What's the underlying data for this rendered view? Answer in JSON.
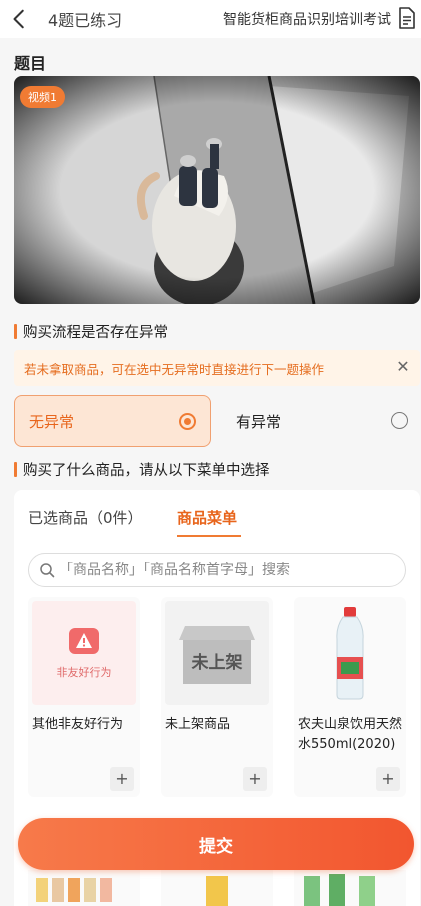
{
  "header": {
    "progress": "4题已练习",
    "title": "智能货柜商品识别培训考试"
  },
  "section_title": "题目",
  "video": {
    "badge": "视频1"
  },
  "question1": {
    "text": "购买流程是否存在异常",
    "notice": "若未拿取商品，可在选中无异常时直接进行下一题操作",
    "options": [
      {
        "label": "无异常",
        "selected": true
      },
      {
        "label": "有异常",
        "selected": false
      }
    ]
  },
  "question2": {
    "text": "购买了什么商品，请从以下菜单中选择",
    "tabs": [
      {
        "label": "已选商品（0件）",
        "active": false
      },
      {
        "label": "商品菜单",
        "active": true
      }
    ],
    "search_placeholder": "「商品名称」「商品名称首字母」搜索",
    "products": [
      {
        "name": "其他非友好行为",
        "image_text": "非友好行为",
        "icon": "warning-icon"
      },
      {
        "name": "未上架商品",
        "image_text": "未上架",
        "icon": "box-icon"
      },
      {
        "name": "农夫山泉饮用天然水550ml(2020)",
        "image_text": "",
        "icon": "water-bottle"
      }
    ]
  },
  "submit_label": "提交",
  "colors": {
    "accent": "#f07b33",
    "notice_bg": "#fff4e8",
    "selected_bg": "#fde6d5"
  }
}
